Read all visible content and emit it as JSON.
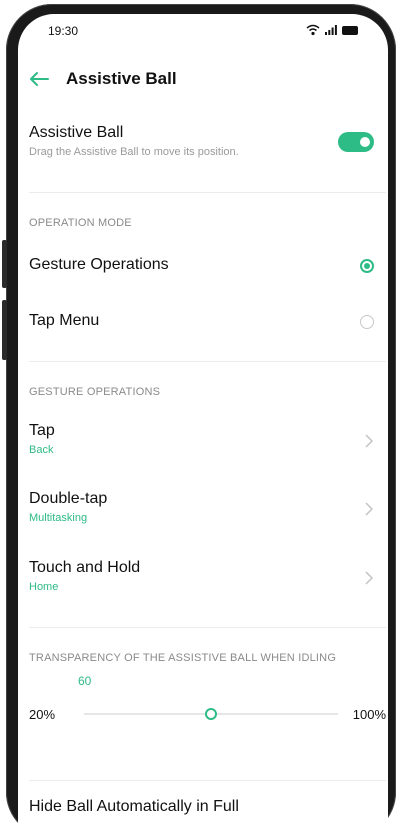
{
  "status": {
    "time": "19:30"
  },
  "header": {
    "title": "Assistive Ball"
  },
  "assistive_ball": {
    "label": "Assistive Ball",
    "sub": "Drag the Assistive Ball to move its position.",
    "enabled": true
  },
  "operation_mode": {
    "section": "OPERATION MODE",
    "options": [
      {
        "label": "Gesture Operations",
        "selected": true
      },
      {
        "label": "Tap Menu",
        "selected": false
      }
    ]
  },
  "gesture_operations": {
    "section": "GESTURE OPERATIONS",
    "items": [
      {
        "label": "Tap",
        "value": "Back"
      },
      {
        "label": "Double-tap",
        "value": "Multitasking"
      },
      {
        "label": "Touch and Hold",
        "value": "Home"
      }
    ]
  },
  "transparency": {
    "section": "TRANSPARENCY OF THE ASSISTIVE BALL WHEN IDLING",
    "value": "60",
    "min_label": "20%",
    "max_label": "100%",
    "level_fraction": 0.5
  },
  "hide_ball": {
    "label": "Hide Ball Automatically in Full"
  },
  "colors": {
    "accent": "#2dbb86"
  }
}
